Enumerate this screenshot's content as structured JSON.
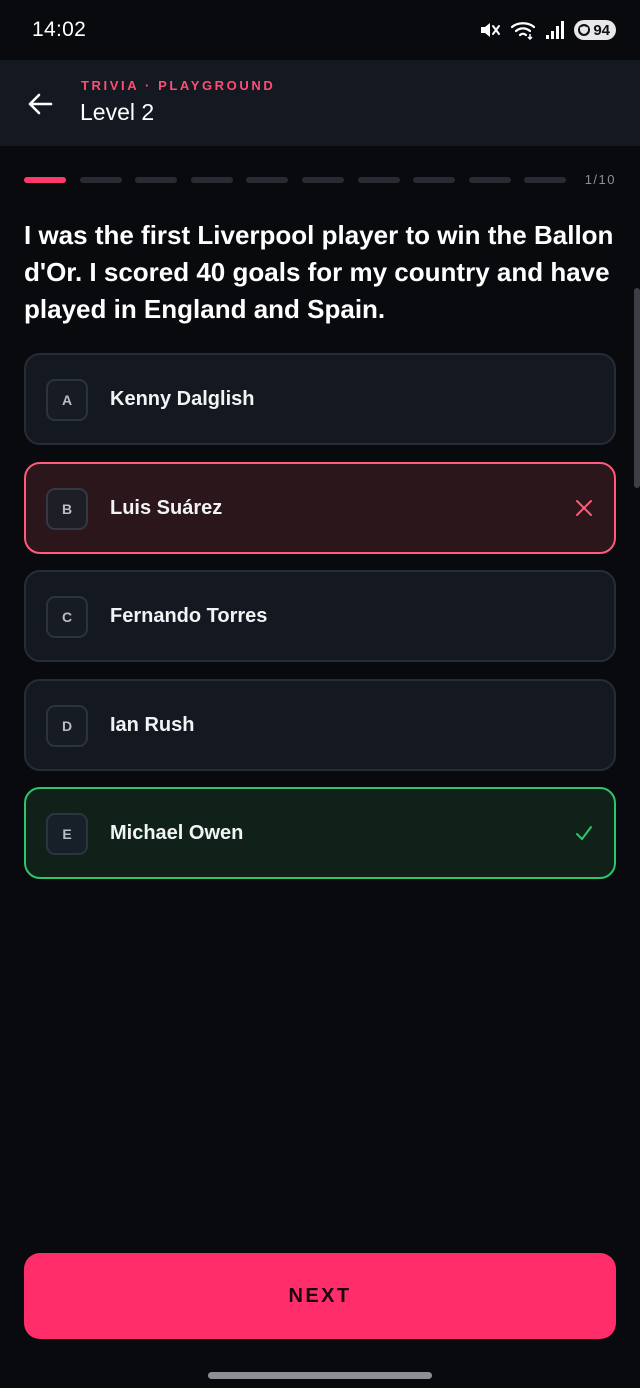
{
  "status_bar": {
    "time": "14:02",
    "battery": "94",
    "icons": [
      "mute-icon",
      "wifi-icon",
      "signal-icon",
      "battery-icon"
    ]
  },
  "header": {
    "overline": "TRIVIA · PLAYGROUND",
    "title": "Level 2"
  },
  "progress": {
    "current": 1,
    "total": 10,
    "label": "1/10"
  },
  "question": "I was the first Liverpool player to win the Ballon d'Or. I scored 40 goals for my country and have played in England and Spain.",
  "options": [
    {
      "letter": "A",
      "text": "Kenny Dalglish",
      "state": "neutral"
    },
    {
      "letter": "B",
      "text": "Luis Suárez",
      "state": "wrong"
    },
    {
      "letter": "C",
      "text": "Fernando Torres",
      "state": "neutral"
    },
    {
      "letter": "D",
      "text": "Ian Rush",
      "state": "neutral"
    },
    {
      "letter": "E",
      "text": "Michael Owen",
      "state": "correct"
    }
  ],
  "next_button": "NEXT",
  "colors": {
    "accent": "#ff2d6a",
    "wrong": "#ff5a79",
    "correct": "#2fc46c",
    "background": "#090a0d",
    "card": "#131821"
  }
}
